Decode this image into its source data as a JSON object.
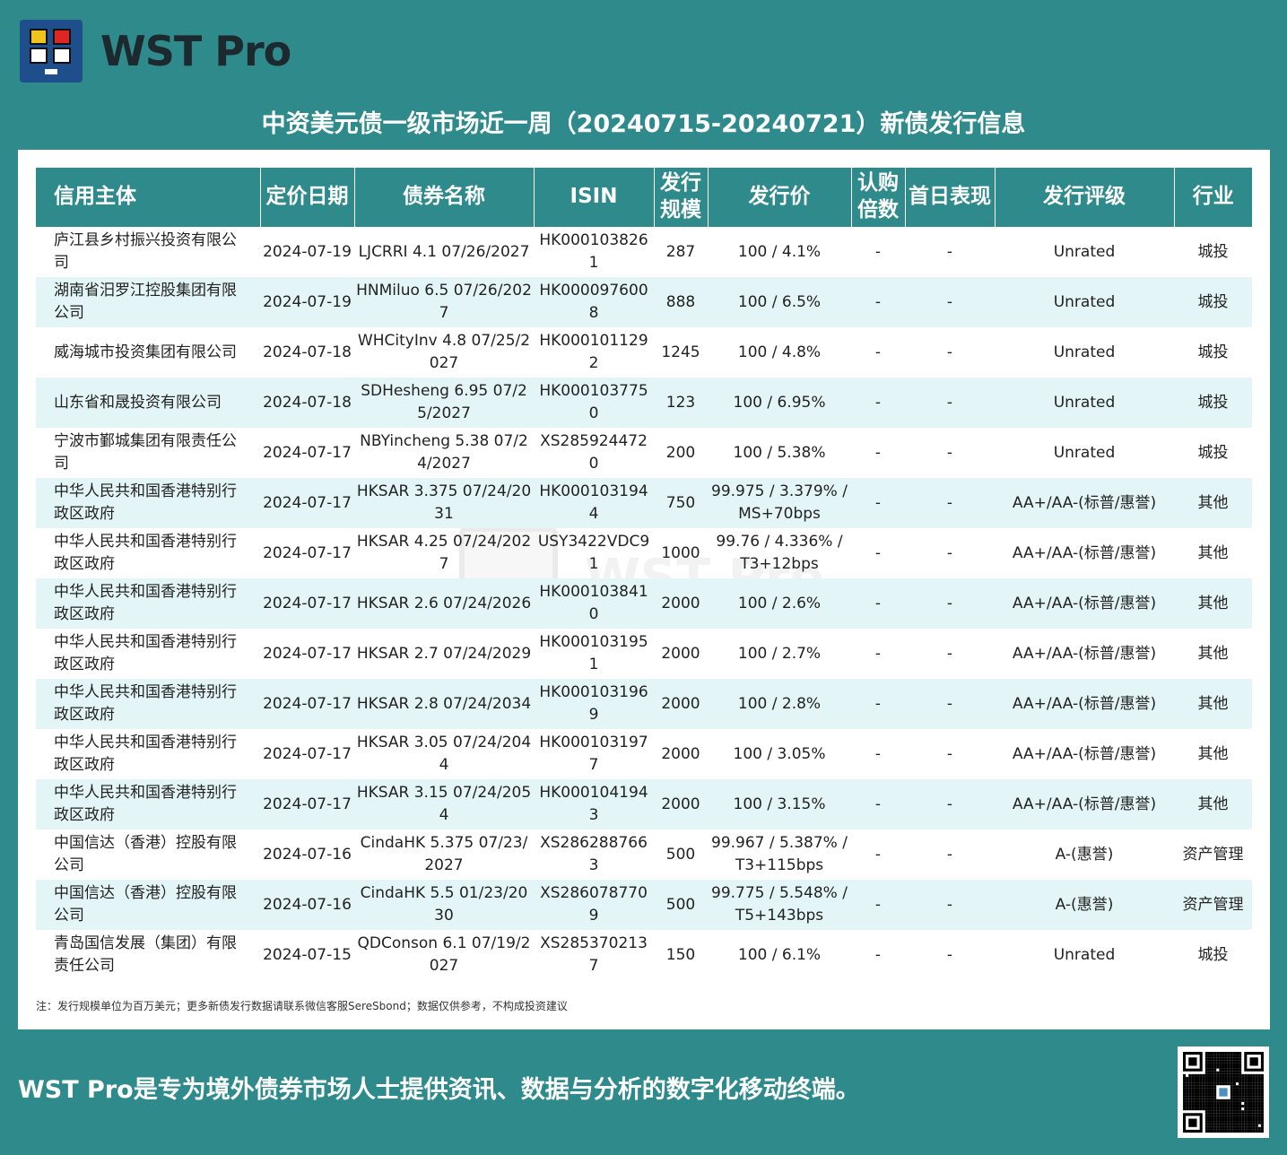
{
  "brand": {
    "name": "WST Pro"
  },
  "title": "中资美元债一级市场近一周（20240715-20240721）新债发行信息",
  "table": {
    "headers": [
      "信用主体",
      "定价日期",
      "债券名称",
      "ISIN",
      "发行规模",
      "发行价",
      "认购倍数",
      "首日表现",
      "发行评级",
      "行业"
    ],
    "rows": [
      [
        "庐江县乡村振兴投资有限公司",
        "2024-07-19",
        "LJCRRI 4.1 07/26/2027",
        "HK0001038261",
        "287",
        "100 / 4.1%",
        "-",
        "-",
        "Unrated",
        "城投"
      ],
      [
        "湖南省汨罗江控股集团有限公司",
        "2024-07-19",
        "HNMiluo 6.5 07/26/2027",
        "HK0000976008",
        "888",
        "100 / 6.5%",
        "-",
        "-",
        "Unrated",
        "城投"
      ],
      [
        "威海城市投资集团有限公司",
        "2024-07-18",
        "WHCityInv 4.8 07/25/2027",
        "HK0001011292",
        "1245",
        "100 / 4.8%",
        "-",
        "-",
        "Unrated",
        "城投"
      ],
      [
        "山东省和晟投资有限公司",
        "2024-07-18",
        "SDHesheng 6.95 07/25/2027",
        "HK0001037750",
        "123",
        "100 / 6.95%",
        "-",
        "-",
        "Unrated",
        "城投"
      ],
      [
        "宁波市鄞城集团有限责任公司",
        "2024-07-17",
        "NBYincheng 5.38 07/24/2027",
        "XS2859244720",
        "200",
        "100 / 5.38%",
        "-",
        "-",
        "Unrated",
        "城投"
      ],
      [
        "中华人民共和国香港特别行政区政府",
        "2024-07-17",
        "HKSAR 3.375 07/24/2031",
        "HK0001031944",
        "750",
        "99.975 / 3.379% / MS+70bps",
        "-",
        "-",
        "AA+/AA-(标普/惠誉)",
        "其他"
      ],
      [
        "中华人民共和国香港特别行政区政府",
        "2024-07-17",
        "HKSAR 4.25 07/24/2027",
        "USY3422VDC91",
        "1000",
        "99.76 / 4.336% / T3+12bps",
        "-",
        "-",
        "AA+/AA-(标普/惠誉)",
        "其他"
      ],
      [
        "中华人民共和国香港特别行政区政府",
        "2024-07-17",
        "HKSAR 2.6 07/24/2026",
        "HK0001038410",
        "2000",
        "100 / 2.6%",
        "-",
        "-",
        "AA+/AA-(标普/惠誉)",
        "其他"
      ],
      [
        "中华人民共和国香港特别行政区政府",
        "2024-07-17",
        "HKSAR 2.7 07/24/2029",
        "HK0001031951",
        "2000",
        "100 / 2.7%",
        "-",
        "-",
        "AA+/AA-(标普/惠誉)",
        "其他"
      ],
      [
        "中华人民共和国香港特别行政区政府",
        "2024-07-17",
        "HKSAR 2.8 07/24/2034",
        "HK0001031969",
        "2000",
        "100 / 2.8%",
        "-",
        "-",
        "AA+/AA-(标普/惠誉)",
        "其他"
      ],
      [
        "中华人民共和国香港特别行政区政府",
        "2024-07-17",
        "HKSAR 3.05 07/24/2044",
        "HK0001031977",
        "2000",
        "100 / 3.05%",
        "-",
        "-",
        "AA+/AA-(标普/惠誉)",
        "其他"
      ],
      [
        "中华人民共和国香港特别行政区政府",
        "2024-07-17",
        "HKSAR 3.15 07/24/2054",
        "HK0001041943",
        "2000",
        "100 / 3.15%",
        "-",
        "-",
        "AA+/AA-(标普/惠誉)",
        "其他"
      ],
      [
        "中国信达（香港）控股有限公司",
        "2024-07-16",
        "CindaHK 5.375 07/23/2027",
        "XS2862887663",
        "500",
        "99.967 / 5.387% / T3+115bps",
        "-",
        "-",
        "A-(惠誉)",
        "资产管理"
      ],
      [
        "中国信达（香港）控股有限公司",
        "2024-07-16",
        "CindaHK 5.5 01/23/2030",
        "XS2860787709",
        "500",
        "99.775 / 5.548% / T5+143bps",
        "-",
        "-",
        "A-(惠誉)",
        "资产管理"
      ],
      [
        "青岛国信发展（集团）有限责任公司",
        "2024-07-15",
        "QDConson 6.1 07/19/2027",
        "XS2853702137",
        "150",
        "100 / 6.1%",
        "-",
        "-",
        "Unrated",
        "城投"
      ]
    ]
  },
  "footnote": "注：发行规模单位为百万美元；更多新债发行数据请联系微信客服SereSbond；数据仅供参考，不构成投资建议",
  "slogan": "WST Pro是专为境外债券市场人士提供资讯、数据与分析的数字化移动终端。",
  "colors": {
    "background": "#2f8a8c",
    "header": "#2f8a8c",
    "stripe": "#e3f5f7",
    "logo": "#1f4e8c"
  },
  "icons": {
    "logo": "wst-pro-logo-icon",
    "qr": "qr-code-icon"
  }
}
